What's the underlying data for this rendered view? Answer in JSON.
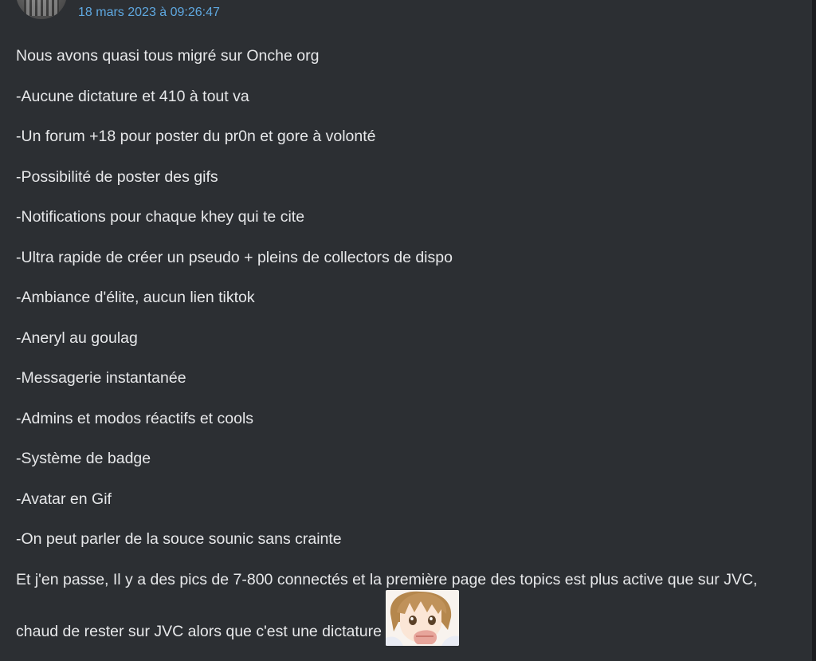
{
  "post": {
    "date": "18 mars 2023 à 09:26:47",
    "lines": [
      "Nous avons quasi tous migré sur Onche org",
      "-Aucune dictature et 410 à tout va",
      "-Un forum +18 pour poster du pr0n et gore à volonté",
      "-Possibilité de poster des gifs",
      "-Notifications pour chaque khey qui te cite",
      "-Ultra rapide de créer un pseudo + pleins de collectors de dispo",
      "-Ambiance d'élite, aucun lien tiktok",
      "-Aneryl au goulag",
      "-Messagerie instantanée",
      "-Admins et modos réactifs et cools",
      "-Système de badge",
      "-Avatar en Gif",
      "-On peut parler de la souce sounic sans crainte",
      "Et j'en passe, Il y a des pics de 7-800 connectés et la première page des topics est plus active que sur JVC,"
    ],
    "closing_line": "chaud de rester sur JVC alors que c'est une dictature",
    "sticker_icon": "anime-girl-sticker-icon",
    "avatar_icon": "user-avatar-icon"
  },
  "colors": {
    "background": "#2c2f33",
    "text": "#e7e8ea",
    "date": "#5fa8e0"
  }
}
